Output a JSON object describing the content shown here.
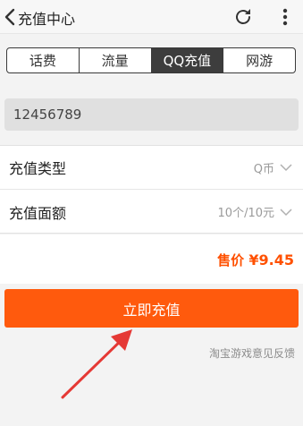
{
  "header": {
    "title": "充值中心"
  },
  "tabs": [
    {
      "label": "话费",
      "active": false
    },
    {
      "label": "流量",
      "active": false
    },
    {
      "label": "QQ充值",
      "active": true
    },
    {
      "label": "网游",
      "active": false
    }
  ],
  "account_input": {
    "value": "12456789"
  },
  "options": {
    "type_label": "充值类型",
    "type_value": "Q币",
    "amount_label": "充值面额",
    "amount_value": "10个/10元"
  },
  "price": {
    "label": "售价",
    "value": "¥9.45"
  },
  "buy_button": {
    "label": "立即充值"
  },
  "feedback_link": "淘宝游戏意见反馈",
  "colors": {
    "accent": "#ff5a0d",
    "price": "#ff5000",
    "arrow": "#e53935"
  },
  "icons": [
    "back-icon",
    "refresh-icon",
    "more-icon",
    "chevron-down-icon"
  ]
}
